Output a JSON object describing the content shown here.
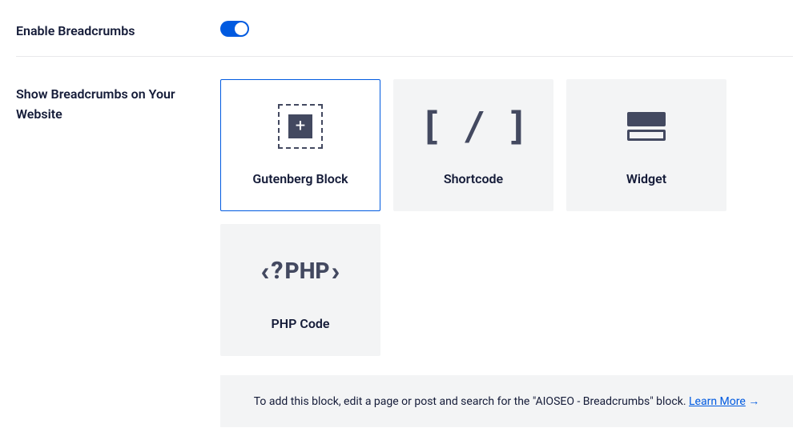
{
  "enable": {
    "label": "Enable Breadcrumbs",
    "value": true
  },
  "show": {
    "label": "Show Breadcrumbs on Your Website"
  },
  "cards": {
    "gutenberg": "Gutenberg Block",
    "shortcode": "Shortcode",
    "widget": "Widget",
    "php": "PHP Code",
    "shortcode_icon": "[ / ]",
    "php_icon_php": "PHP"
  },
  "info": {
    "text": "To add this block, edit a page or post and search for the \"AIOSEO - Breadcrumbs\" block. ",
    "link_text": "Learn More",
    "arrow": "→"
  }
}
